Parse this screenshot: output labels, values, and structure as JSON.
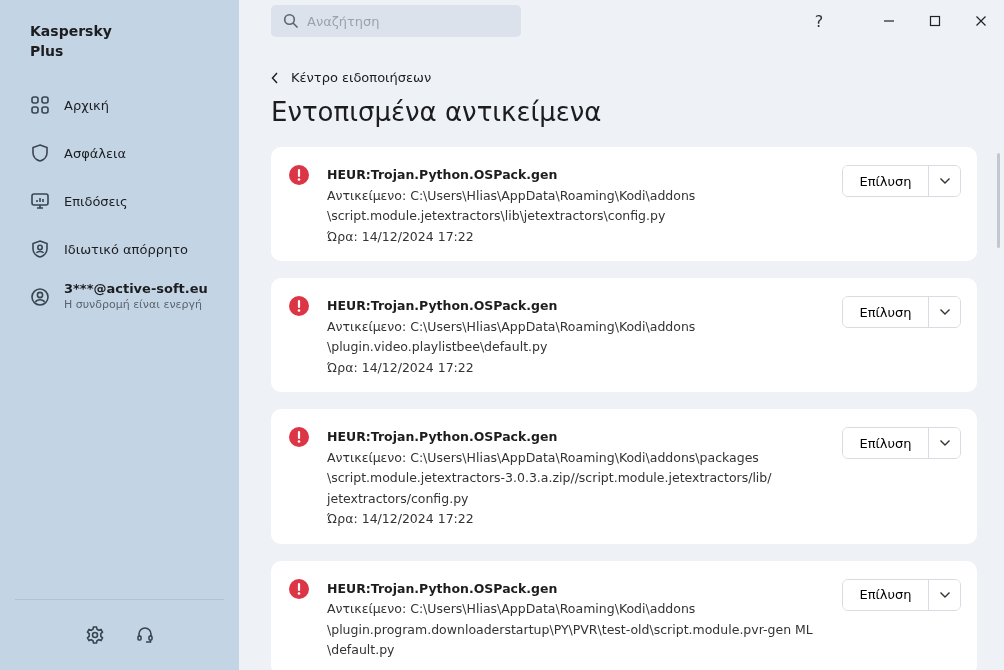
{
  "sidebar": {
    "brand": "Kaspersky\nPlus",
    "items": [
      {
        "kind": "home",
        "label": "Αρχική"
      },
      {
        "kind": "shield",
        "label": "Ασφάλεια"
      },
      {
        "kind": "monitor",
        "label": "Επιδόσεις"
      },
      {
        "kind": "privacy",
        "label": "Ιδιωτικό απόρρητο"
      }
    ],
    "account": {
      "email": "3***@active-soft.eu",
      "status": "Η συνδρομή είναι ενεργή"
    }
  },
  "search": {
    "placeholder": "Αναζήτηση"
  },
  "window": {
    "help": "?"
  },
  "breadcrumb": "Κέντρο ειδοποιήσεων",
  "title": "Εντοπισμένα αντικείμενα",
  "detections": [
    {
      "name": "HEUR:Trojan.Python.OSPack.gen",
      "object_lines": [
        "Αντικείμενο: C:\\Users\\Hlias\\AppData\\Roaming\\Kodi\\addons",
        "\\script.module.jetextractors\\lib\\jetextractors\\config.py"
      ],
      "time": "Ώρα: 14/12/2024 17:22",
      "action": "Επίλυση"
    },
    {
      "name": "HEUR:Trojan.Python.OSPack.gen",
      "object_lines": [
        "Αντικείμενο: C:\\Users\\Hlias\\AppData\\Roaming\\Kodi\\addons",
        "\\plugin.video.playlistbee\\default.py"
      ],
      "time": "Ώρα: 14/12/2024 17:22",
      "action": "Επίλυση"
    },
    {
      "name": "HEUR:Trojan.Python.OSPack.gen",
      "object_lines": [
        "Αντικείμενο: C:\\Users\\Hlias\\AppData\\Roaming\\Kodi\\addons\\packages",
        "\\script.module.jetextractors-3.0.3.a.zip//script.module.jetextractors/lib/",
        "jetextractors/config.py"
      ],
      "time": "Ώρα: 14/12/2024 17:22",
      "action": "Επίλυση"
    },
    {
      "name": "HEUR:Trojan.Python.OSPack.gen",
      "object_lines": [
        "Αντικείμενο: C:\\Users\\Hlias\\AppData\\Roaming\\Kodi\\addons",
        "\\plugin.program.downloaderstartup\\PY\\PVR\\test-old\\script.module.pvr-gen ML",
        "\\default.py"
      ],
      "action": "Επίλυση"
    }
  ]
}
